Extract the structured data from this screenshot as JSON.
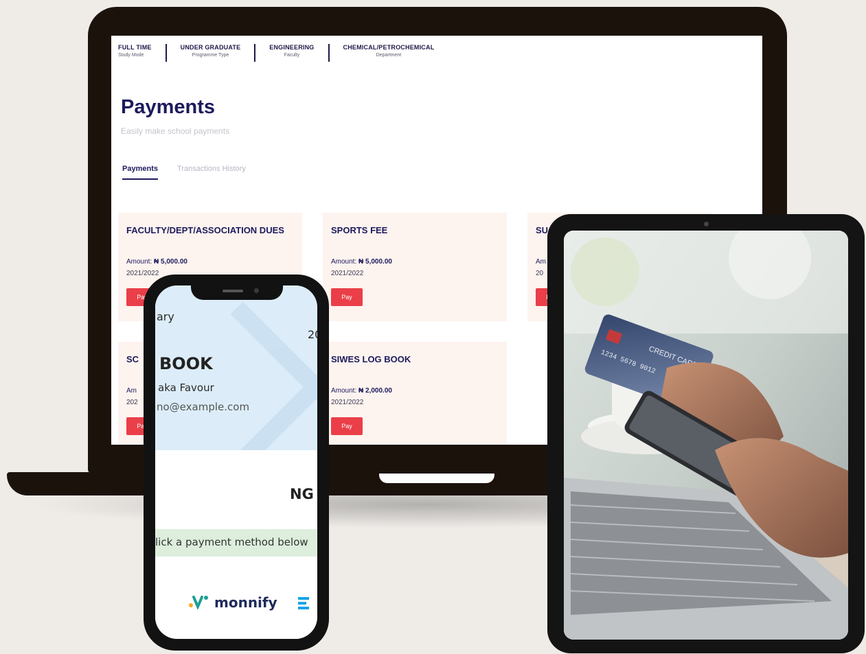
{
  "laptop": {
    "info_bar": [
      {
        "value": "FULL TIME",
        "label": "Study Mode"
      },
      {
        "value": "UNDER GRADUATE",
        "label": "Programme Type"
      },
      {
        "value": "ENGINEERING",
        "label": "Faculty"
      },
      {
        "value": "CHEMICAL/PETROCHEMICAL",
        "label": "Department"
      }
    ],
    "title": "Payments",
    "subtitle": "Easily make school payments",
    "tabs": [
      {
        "label": "Payments",
        "active": true
      },
      {
        "label": "Transactions History",
        "active": false
      }
    ],
    "cards": [
      {
        "title": "FACULTY/DEPT/ASSOCIATION DUES",
        "amount_label": "Amount:",
        "amount": "₦ 5,000.00",
        "session": "2021/2022",
        "button": "Pay"
      },
      {
        "title": "SPORTS FEE",
        "amount_label": "Amount:",
        "amount": "₦ 5,000.00",
        "session": "2021/2022",
        "button": "Pay"
      },
      {
        "title": "SU",
        "amount_label": "Am",
        "amount": "",
        "session": "20",
        "button": "Pay"
      },
      {
        "title": "SC",
        "amount_label": "Am",
        "amount": "",
        "session": "202",
        "button": "Pay"
      },
      {
        "title": "SIWES LOG BOOK",
        "amount_label": "Amount:",
        "amount": "₦ 2,000.00",
        "session": "2021/2022",
        "button": "Pay"
      }
    ]
  },
  "phone": {
    "header_fragment_1": "ary",
    "header_fragment_2": "20",
    "item_title": "BOOK",
    "payer_name": "aka Favour",
    "payer_email": "no@example.com",
    "currency_fragment": "NG",
    "notice": "lick a payment method below",
    "provider": "monnify",
    "colors": {
      "header_bg": "#dcedf9",
      "notice_bg": "#ddeedd",
      "monnify_teal": "#1e9e96",
      "monnify_navy": "#1d2a5c"
    }
  },
  "tablet": {
    "photo": "hands holding credit card and smartphone over laptop",
    "card_text": "CREDIT CARD"
  },
  "colors": {
    "background": "#efece8",
    "device_frame": "#1c120c",
    "primary_navy": "#1d1a5c",
    "pay_button": "#ea3f48",
    "card_bg": "#fdf3ef"
  }
}
